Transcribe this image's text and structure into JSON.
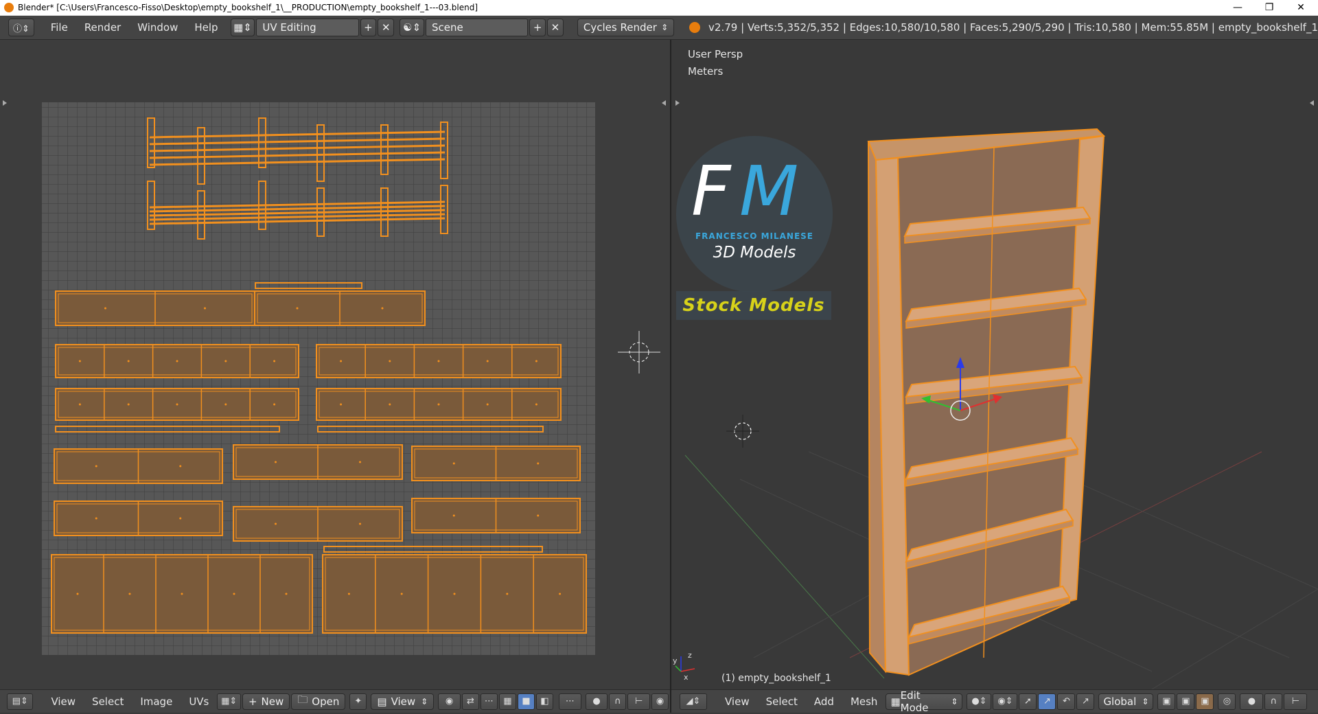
{
  "window": {
    "title": "Blender* [C:\\Users\\Francesco-Fisso\\Desktop\\empty_bookshelf_1\\__PRODUCTION\\empty_bookshelf_1---03.blend]",
    "minimize": "—",
    "restore": "❐",
    "close": "✕"
  },
  "infobar": {
    "menus": [
      "File",
      "Render",
      "Window",
      "Help"
    ],
    "layout": "UV Editing",
    "scene": "Scene",
    "engine": "Cycles Render",
    "stats": "v2.79 | Verts:5,352/5,352 | Edges:10,580/10,580 | Faces:5,290/5,290 | Tris:10,580 | Mem:55.85M | empty_bookshelf_1"
  },
  "viewport": {
    "view_label": "User Persp",
    "units_label": "Meters",
    "object_label": "(1) empty_bookshelf_1"
  },
  "logo": {
    "initials_f": "F",
    "initials_m": "M",
    "name": "FRANCESCO MILANESE",
    "tagline": "3D Models",
    "stock": "Stock Models"
  },
  "uv_footer": {
    "menus": [
      "View",
      "Select",
      "Image",
      "UVs"
    ],
    "new_label": "New",
    "open_label": "Open",
    "view_label": "View"
  },
  "view3d_footer": {
    "menus": [
      "View",
      "Select",
      "Add",
      "Mesh"
    ],
    "mode": "Edit Mode",
    "orientation": "Global"
  },
  "colors": {
    "accent_orange": "#f2901e",
    "uv_fill": "#7a5a3a",
    "logo_blue": "#3aa7dc",
    "stock_yellow": "#d7d21a"
  }
}
